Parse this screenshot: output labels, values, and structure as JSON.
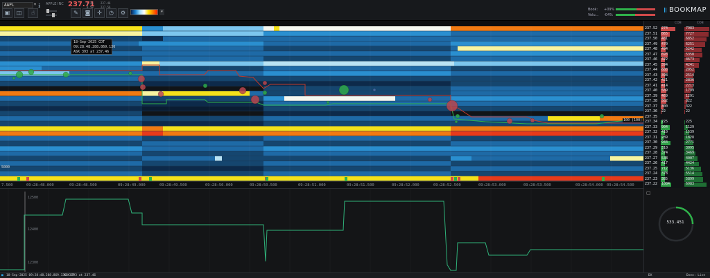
{
  "toolbar": {
    "symbol": "AAPL",
    "company": "APPLE INC",
    "last_price": "237.71",
    "quote_small": [
      "1.36",
      "0.58",
      "237.46",
      "237.56"
    ],
    "book_label": "Book:",
    "book_pct": "+09%",
    "volume_label": "Volu...",
    "volume_pct": "-04%",
    "brand": "BOOKMAP",
    "colors": {
      "ask": "#ef5b5b",
      "bid": "#2fb24a",
      "accent": "#2ca4e6"
    }
  },
  "tooltip": {
    "line1": "18-Sep-2025 CDT",
    "line2": "09:28:48.288.869.136",
    "line3": "ASK 393 at 237.46"
  },
  "markers": {
    "left_size": "5000",
    "ladder_tag": "100 (100)"
  },
  "ladder": {
    "header_left": "COB",
    "header_right": "COB",
    "rows": [
      {
        "p": "237.52",
        "v": "274",
        "c": "7983",
        "s": "a",
        "w": 0.95,
        "cw": 1.0
      },
      {
        "p": "237.51",
        "v": "865",
        "c": "7727",
        "s": "a",
        "w": 0.6,
        "cw": 0.98
      },
      {
        "p": "237.50",
        "v": "481",
        "c": "6852",
        "s": "a",
        "w": 0.3,
        "cw": 0.9
      },
      {
        "p": "237.49",
        "v": "470",
        "c": "6251",
        "s": "a",
        "w": 0.3,
        "cw": 0.82
      },
      {
        "p": "237.48",
        "v": "494",
        "c": "5242",
        "s": "a",
        "w": 0.3,
        "cw": 0.7
      },
      {
        "p": "237.47",
        "v": "693",
        "c": "5358",
        "s": "a",
        "w": 0.45,
        "cw": 0.72
      },
      {
        "p": "237.46",
        "v": "422",
        "c": "4673",
        "s": "a",
        "w": 0.28,
        "cw": 0.62
      },
      {
        "p": "237.45",
        "v": "394",
        "c": "4241",
        "s": "a",
        "w": 0.26,
        "cw": 0.58
      },
      {
        "p": "237.44",
        "v": "688",
        "c": "2952",
        "s": "a",
        "w": 0.45,
        "cw": 0.42
      },
      {
        "p": "237.43",
        "v": "398",
        "c": "2514",
        "s": "a",
        "w": 0.26,
        "cw": 0.36
      },
      {
        "p": "237.42",
        "v": "421",
        "c": "2836",
        "s": "a",
        "w": 0.28,
        "cw": 0.4
      },
      {
        "p": "237.41",
        "v": "414",
        "c": "2213",
        "s": "a",
        "w": 0.27,
        "cw": 0.32
      },
      {
        "p": "237.40",
        "v": "589",
        "c": "1799",
        "s": "a",
        "w": 0.38,
        "cw": 0.26
      },
      {
        "p": "237.39",
        "v": "469",
        "c": "1291",
        "s": "a",
        "w": 0.3,
        "cw": 0.19
      },
      {
        "p": "237.38",
        "v": "582",
        "c": "822",
        "s": "a",
        "w": 0.38,
        "cw": 0.12
      },
      {
        "p": "237.37",
        "v": "300",
        "c": "322",
        "s": "a",
        "w": 0.2,
        "cw": 0.05
      },
      {
        "p": "237.36",
        "v": "22",
        "c": "22",
        "s": "a",
        "w": 0.02,
        "cw": 0.01
      },
      {
        "p": "237.35",
        "v": "",
        "c": "",
        "s": "n",
        "w": 0,
        "cw": 0
      },
      {
        "p": "237.34",
        "v": "225",
        "c": "225",
        "s": "b",
        "w": 0.15,
        "cw": 0.03
      },
      {
        "p": "237.33",
        "v": "904",
        "c": "1129",
        "s": "b",
        "w": 0.6,
        "cw": 0.15
      },
      {
        "p": "237.32",
        "v": "410",
        "c": "1539",
        "s": "b",
        "w": 0.27,
        "cw": 0.2
      },
      {
        "p": "237.31",
        "v": "289",
        "c": "1828",
        "s": "b",
        "w": 0.19,
        "cw": 0.24
      },
      {
        "p": "237.30",
        "v": "943",
        "c": "2771",
        "s": "b",
        "w": 0.62,
        "cw": 0.36
      },
      {
        "p": "237.29",
        "v": "310",
        "c": "3095",
        "s": "b",
        "w": 0.2,
        "cw": 0.4
      },
      {
        "p": "237.28",
        "v": "374",
        "c": "3469",
        "s": "b",
        "w": 0.25,
        "cw": 0.45
      },
      {
        "p": "237.27",
        "v": "538",
        "c": "4007",
        "s": "b",
        "w": 0.35,
        "cw": 0.52
      },
      {
        "p": "237.26",
        "v": "417",
        "c": "4424",
        "s": "b",
        "w": 0.27,
        "cw": 0.57
      },
      {
        "p": "237.25",
        "v": "712",
        "c": "5136",
        "s": "b",
        "w": 0.47,
        "cw": 0.66
      },
      {
        "p": "237.24",
        "v": "378",
        "c": "5514",
        "s": "b",
        "w": 0.25,
        "cw": 0.71
      },
      {
        "p": "237.23",
        "v": "385",
        "c": "5899",
        "s": "b",
        "w": 0.25,
        "cw": 0.76
      },
      {
        "p": "237.22",
        "v": "1084",
        "c": "6983",
        "s": "b",
        "w": 0.7,
        "cw": 0.9
      }
    ]
  },
  "time_labels": [
    "7.500",
    "09:28:48.000",
    "09:28:48.500",
    "09:28:49.000",
    "09:28:49.500",
    "09:28:50.000",
    "09:28:50.500",
    "09:28:51.000",
    "09:28:51.500",
    "09:28:52.000",
    "09:28:52.500",
    "09:28:53.000",
    "09:28:53.500",
    "09:28:54.000",
    "09:28:54.500"
  ],
  "indicator": {
    "y_labels": [
      "12500",
      "12400",
      "12300"
    ],
    "gauge_value": "533.451"
  },
  "status": {
    "left": "18-Sep-2025 09:28:48.288.869.136 CDT",
    "ask": "ASK 393 at 237.46",
    "center": "DX",
    "right": "Dxeo: Live"
  }
}
